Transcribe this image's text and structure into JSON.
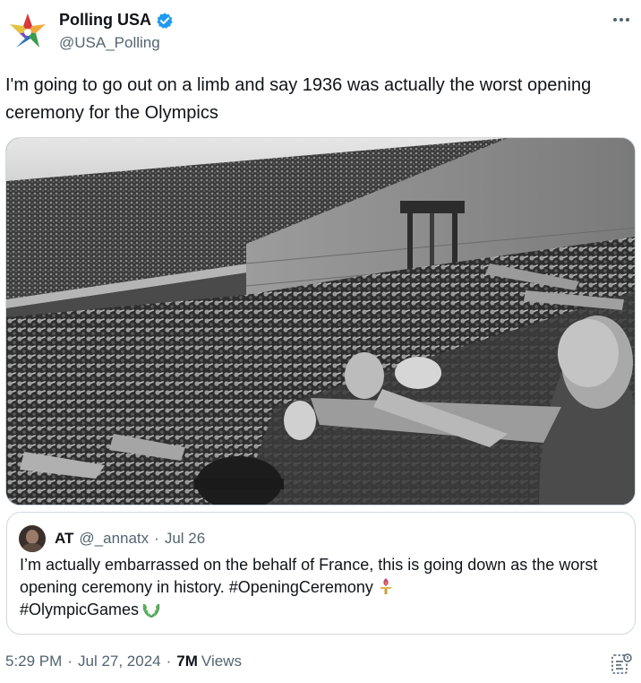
{
  "author": {
    "display_name": "Polling USA",
    "handle": "@USA_Polling",
    "verified": true,
    "avatar_icon": "star-logo-icon"
  },
  "tweet": {
    "text": "I'm going to go out on a limb and say 1936 was actually the worst opening ceremony for the Olympics"
  },
  "quote": {
    "display_name": "AT",
    "handle": "@_annatx",
    "separator": "·",
    "date": "Jul 26",
    "text_main": "I’m actually embarrassed on the behalf of France, this is going down as the worst opening ceremony in history. #OpeningCeremony",
    "text_tag2": "#OlympicGames",
    "emoji_1": "olympic-torch-icon",
    "emoji_2": "laurel-wreath-icon"
  },
  "meta": {
    "time": "5:29 PM",
    "separator": "·",
    "date": "Jul 27, 2024",
    "views_count": "7M",
    "views_label": "Views"
  },
  "colors": {
    "verified_blue": "#1d9bf0",
    "secondary_text": "#536471",
    "primary_text": "#0f1419",
    "border": "#cfd9de"
  }
}
